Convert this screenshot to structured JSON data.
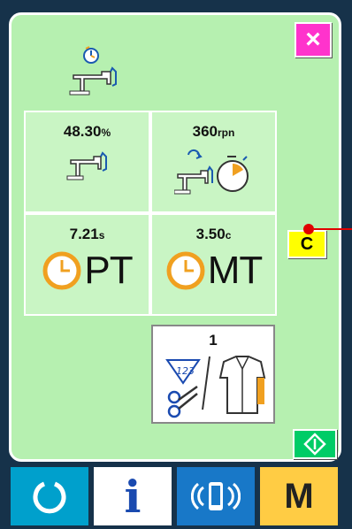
{
  "header": {
    "close_label": "×",
    "mode_icon": "sewing-machine-timer-icon"
  },
  "stats": [
    {
      "value": "48.30",
      "unit": "%",
      "icon": "sewing-machine-icon"
    },
    {
      "value": "360",
      "unit": "rpn",
      "icon": "sewing-speed-timer-icon"
    },
    {
      "value": "7.21",
      "unit": "s",
      "icon": "clock-icon",
      "label": "PT"
    },
    {
      "value": "3.50",
      "unit": "c",
      "icon": "clock-icon",
      "label": "MT"
    }
  ],
  "c_button": {
    "label": "C"
  },
  "counter": {
    "value": "1",
    "icon": "counter-scissors-shirt-icon"
  },
  "ready_button": {
    "icon": "ready-diamond-icon"
  },
  "bottom_bar": [
    {
      "icon": "power-cycle-icon",
      "color": "#00a0cc"
    },
    {
      "label": "i",
      "icon": "info-icon",
      "color": "#ffffff"
    },
    {
      "icon": "communication-icon",
      "color": "#1878c8"
    },
    {
      "label": "M",
      "icon": "mode-icon",
      "color": "#ffcc44"
    }
  ],
  "colors": {
    "screen": "#b6f0b0",
    "cell": "#c9f5c4",
    "close": "#ff33cc",
    "c_button": "#ffff00",
    "ready": "#00cc66",
    "clock": "#f0a020"
  }
}
